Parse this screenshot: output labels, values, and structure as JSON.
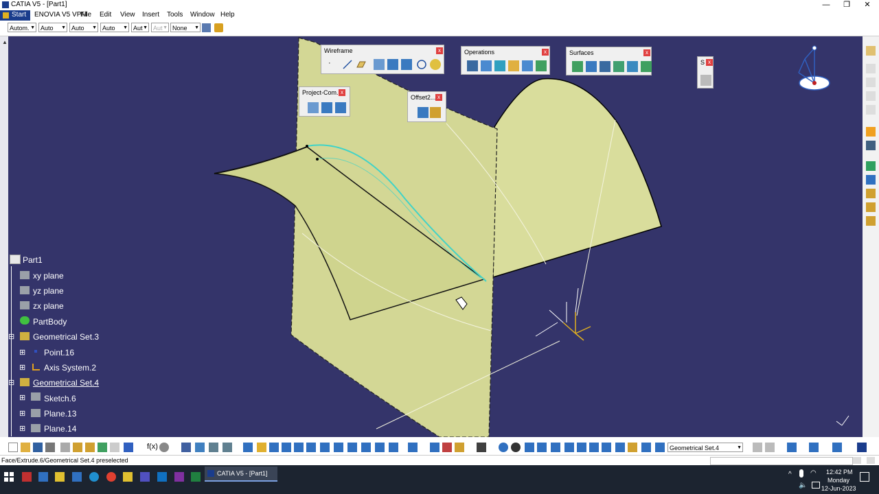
{
  "window": {
    "title": "CATIA V5 - [Part1]",
    "minimize": "—",
    "restore": "❐",
    "close": "✕"
  },
  "menu": [
    "Start",
    "ENOVIA V5 VPM",
    "File",
    "Edit",
    "View",
    "Insert",
    "Tools",
    "Window",
    "Help"
  ],
  "top_toolbar": {
    "combos": [
      "Autom.",
      "Auto",
      "Auto",
      "Auto",
      "Aut",
      "Aut",
      "None"
    ]
  },
  "floating_toolbars": {
    "wireframe": {
      "title": "Wireframe",
      "close": "x"
    },
    "operations": {
      "title": "Operations",
      "close": "x"
    },
    "surfaces": {
      "title": "Surfaces",
      "close": "x"
    },
    "project": {
      "title": "Project-Com...",
      "close": "x"
    },
    "offset": {
      "title": "Offset2...",
      "close": "x"
    },
    "small": {
      "title": "S",
      "close": "x"
    }
  },
  "tree": {
    "root": "Part1",
    "items": [
      {
        "label": "xy plane"
      },
      {
        "label": "yz plane"
      },
      {
        "label": "zx plane"
      },
      {
        "label": "PartBody"
      },
      {
        "label": "Geometrical Set.3"
      },
      {
        "label": "Point.16"
      },
      {
        "label": "Axis System.2"
      },
      {
        "label": "Geometrical Set.4"
      },
      {
        "label": "Sketch.6"
      },
      {
        "label": "Plane.13"
      },
      {
        "label": "Plane.14"
      }
    ]
  },
  "bottom_toolbar": {
    "geo_set_combo": "Geometrical Set.4"
  },
  "status": {
    "text": "Face/Extrude.6/Geometrical Set.4 preselected"
  },
  "taskbar": {
    "app": "CATIA V5 - [Part1]",
    "time": "12:42 PM",
    "day": "Monday",
    "date": "12-Jun-2023"
  },
  "colors": {
    "viewport": "#34346a",
    "surface": "#d7dc9a",
    "highlight": "#3fd3c8",
    "tree_text": "#ffffff"
  }
}
